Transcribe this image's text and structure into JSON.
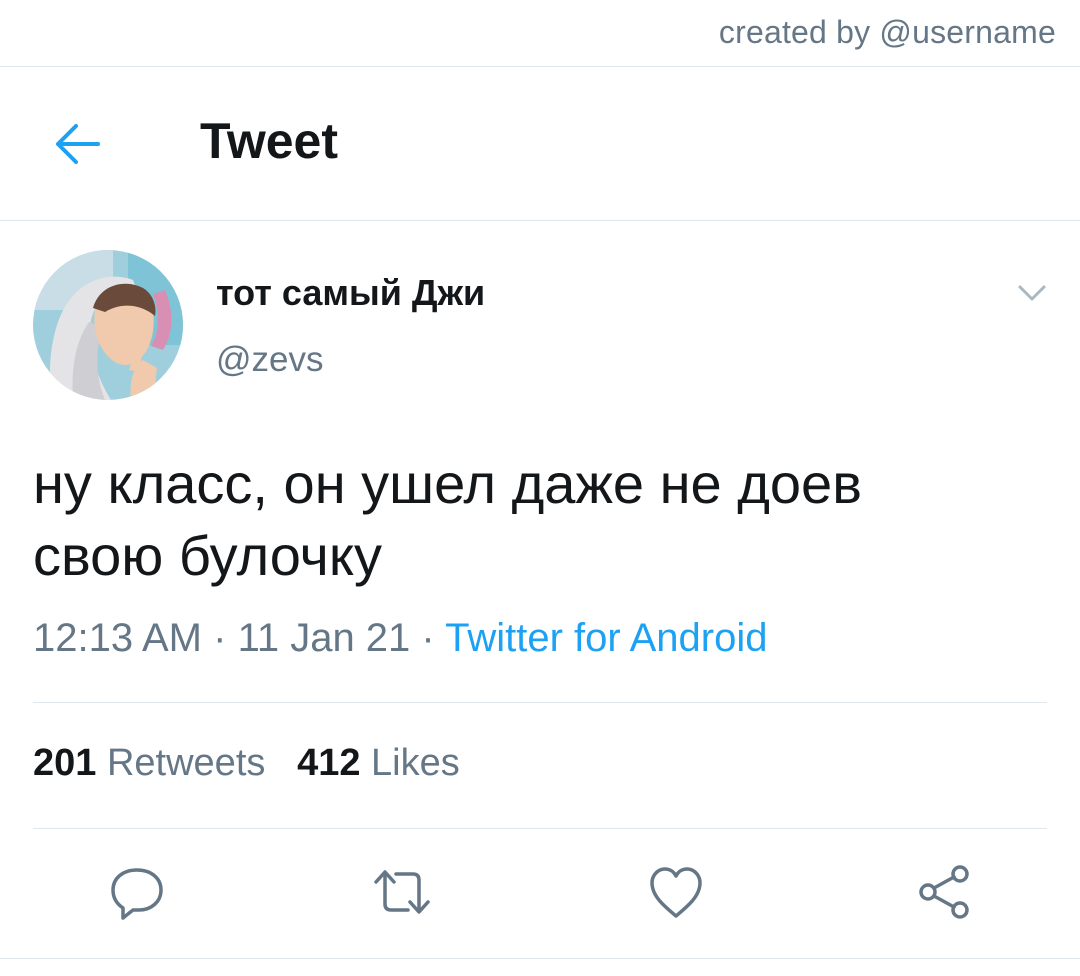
{
  "watermark": "created by @username",
  "header": {
    "title": "Tweet",
    "back_icon": "arrow-left-icon"
  },
  "tweet": {
    "display_name": "тот самый Джи",
    "handle": "@zevs",
    "text_line1": "ну класс, он ушел даже не доев",
    "text_line2": "свою булочку",
    "time": "12:13 AM",
    "separator": " · ",
    "date": "11 Jan 21",
    "source": "Twitter for Android"
  },
  "stats": {
    "retweets_count": "201",
    "retweets_label": "Retweets",
    "likes_count": "412",
    "likes_label": "Likes"
  },
  "actions": {
    "reply_icon": "reply-icon",
    "retweet_icon": "retweet-icon",
    "like_icon": "heart-icon",
    "share_icon": "share-icon"
  },
  "colors": {
    "accent": "#1da1f2",
    "secondary_text": "#657786",
    "primary_text": "#14171a",
    "divider": "#e1e8ed"
  }
}
